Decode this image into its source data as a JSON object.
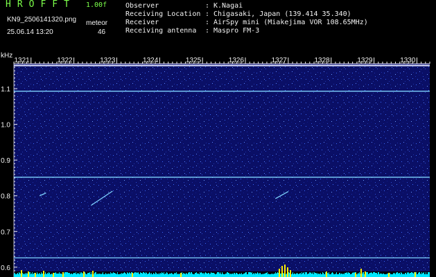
{
  "header": {
    "brand": "HROFFT",
    "version": "1.00f",
    "filename": "KN9_2506141320.png",
    "mode_label": "meteor",
    "timestamp": "25.06.14 13:20",
    "count": "46"
  },
  "info": [
    {
      "key": "Observer",
      "sep": ":",
      "value": "K.Nagai"
    },
    {
      "key": "Receiving Location",
      "sep": ":",
      "value": "Chigasaki, Japan (139.414 35.340)"
    },
    {
      "key": "Receiver",
      "sep": ":",
      "value": "AirSpy mini (Miakejima VOR 108.65MHz)"
    },
    {
      "key": "Receiving antenna",
      "sep": ":",
      "value": "Maspro FM-3"
    }
  ],
  "chart_data": {
    "type": "heatmap",
    "title": "",
    "xlabel": "",
    "ylabel": "kHz",
    "x_ticks": [
      "1321",
      "1322",
      "1323",
      "1324",
      "1325",
      "1326",
      "1327",
      "1328",
      "1329",
      "1330"
    ],
    "x_range": [
      1320.6,
      1330.3
    ],
    "y_ticks": [
      1.1,
      1.0,
      0.9,
      0.8,
      0.7,
      0.6
    ],
    "y_range": [
      0.588,
      1.17
    ],
    "horizontal_lines_khz": [
      1.165,
      1.093,
      0.852,
      0.626
    ],
    "meteor_echoes": [
      {
        "x_start": 1322.4,
        "x_end": 1322.9,
        "y_start": 0.773,
        "y_end": 0.813
      },
      {
        "x_start": 1326.7,
        "x_end": 1327.0,
        "y_start": 0.792,
        "y_end": 0.812
      },
      {
        "x_start": 1321.2,
        "x_end": 1321.35,
        "y_start": 0.8,
        "y_end": 0.808
      }
    ],
    "colors": {
      "background": "#000000",
      "spectrogram_base": "#0a0f66",
      "noise_light": "#3a6bff",
      "carrier_line": "#7fd3ff",
      "power_bar": "#00e5ff",
      "power_spike": "#ffee00",
      "header_green": "#7CFF4A"
    }
  }
}
